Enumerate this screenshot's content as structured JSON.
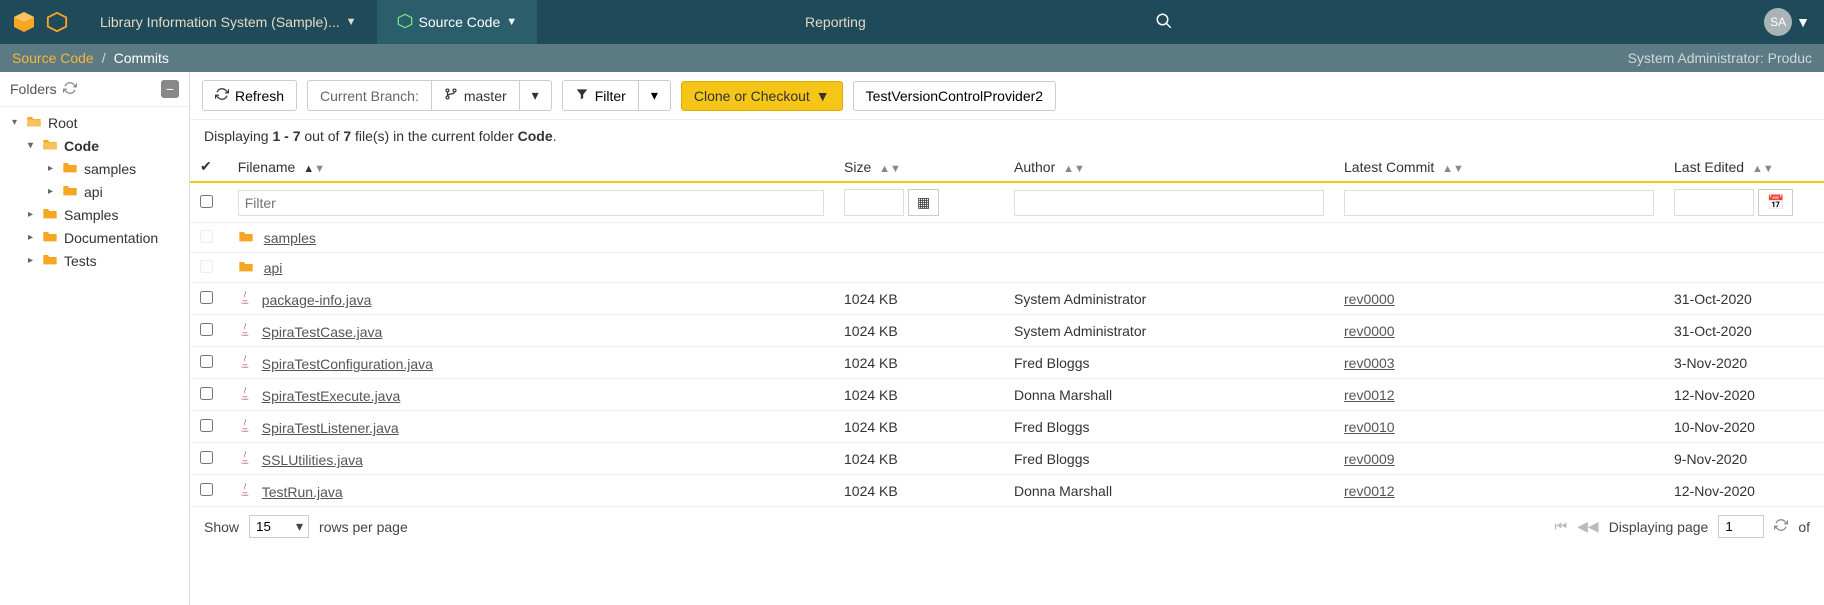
{
  "nav": {
    "workspace_label": "Library Information System (Sample)...",
    "source_code_label": "Source Code",
    "reporting_label": "Reporting",
    "avatar_initials": "SA"
  },
  "breadcrumb": {
    "root": "Source Code",
    "current": "Commits",
    "right_text": "System Administrator: Produc"
  },
  "sidebar": {
    "title": "Folders",
    "nodes": [
      {
        "level": 1,
        "label": "Root",
        "expanded": true,
        "open": true
      },
      {
        "level": 2,
        "label": "Code",
        "expanded": true,
        "open": true,
        "active": true
      },
      {
        "level": 3,
        "label": "samples",
        "expanded": false,
        "open": false,
        "leaf": true
      },
      {
        "level": 3,
        "label": "api",
        "expanded": false,
        "open": false,
        "leaf": true
      },
      {
        "level": 2,
        "label": "Samples",
        "expanded": false,
        "open": false,
        "leaf": true
      },
      {
        "level": 2,
        "label": "Documentation",
        "expanded": false,
        "open": false,
        "leaf": true
      },
      {
        "level": 2,
        "label": "Tests",
        "expanded": false,
        "open": false,
        "leaf": true
      }
    ]
  },
  "toolbar": {
    "refresh_label": "Refresh",
    "branch_title": "Current Branch:",
    "branch_name": "master",
    "filter_label": "Filter",
    "clone_label": "Clone or Checkout",
    "provider_label": "TestVersionControlProvider2"
  },
  "summary": {
    "prefix": "Displaying ",
    "range": "1 - 7",
    "mid": " out of ",
    "total": "7",
    "suffix": " file(s) in the current folder ",
    "folder": "Code",
    "period": "."
  },
  "columns": {
    "filename": "Filename",
    "size": "Size",
    "author": "Author",
    "commit": "Latest Commit",
    "edited": "Last Edited"
  },
  "filter": {
    "placeholder": "Filter"
  },
  "rows": [
    {
      "type": "folder",
      "name": "samples"
    },
    {
      "type": "folder",
      "name": "api"
    },
    {
      "type": "file",
      "name": "package-info.java",
      "size": "1024 KB",
      "author": "System Administrator",
      "commit": "rev0000",
      "edited": "31-Oct-2020"
    },
    {
      "type": "file",
      "name": "SpiraTestCase.java",
      "size": "1024 KB",
      "author": "System Administrator",
      "commit": "rev0000",
      "edited": "31-Oct-2020"
    },
    {
      "type": "file",
      "name": "SpiraTestConfiguration.java",
      "size": "1024 KB",
      "author": "Fred Bloggs",
      "commit": "rev0003",
      "edited": "3-Nov-2020"
    },
    {
      "type": "file",
      "name": "SpiraTestExecute.java",
      "size": "1024 KB",
      "author": "Donna Marshall",
      "commit": "rev0012",
      "edited": "12-Nov-2020"
    },
    {
      "type": "file",
      "name": "SpiraTestListener.java",
      "size": "1024 KB",
      "author": "Fred Bloggs",
      "commit": "rev0010",
      "edited": "10-Nov-2020"
    },
    {
      "type": "file",
      "name": "SSLUtilities.java",
      "size": "1024 KB",
      "author": "Fred Bloggs",
      "commit": "rev0009",
      "edited": "9-Nov-2020"
    },
    {
      "type": "file",
      "name": "TestRun.java",
      "size": "1024 KB",
      "author": "Donna Marshall",
      "commit": "rev0012",
      "edited": "12-Nov-2020"
    }
  ],
  "footer": {
    "show_label": "Show",
    "rows_value": "15",
    "rows_suffix": "rows per page",
    "displaying": "Displaying page",
    "page_value": "1",
    "of_label": "of"
  }
}
